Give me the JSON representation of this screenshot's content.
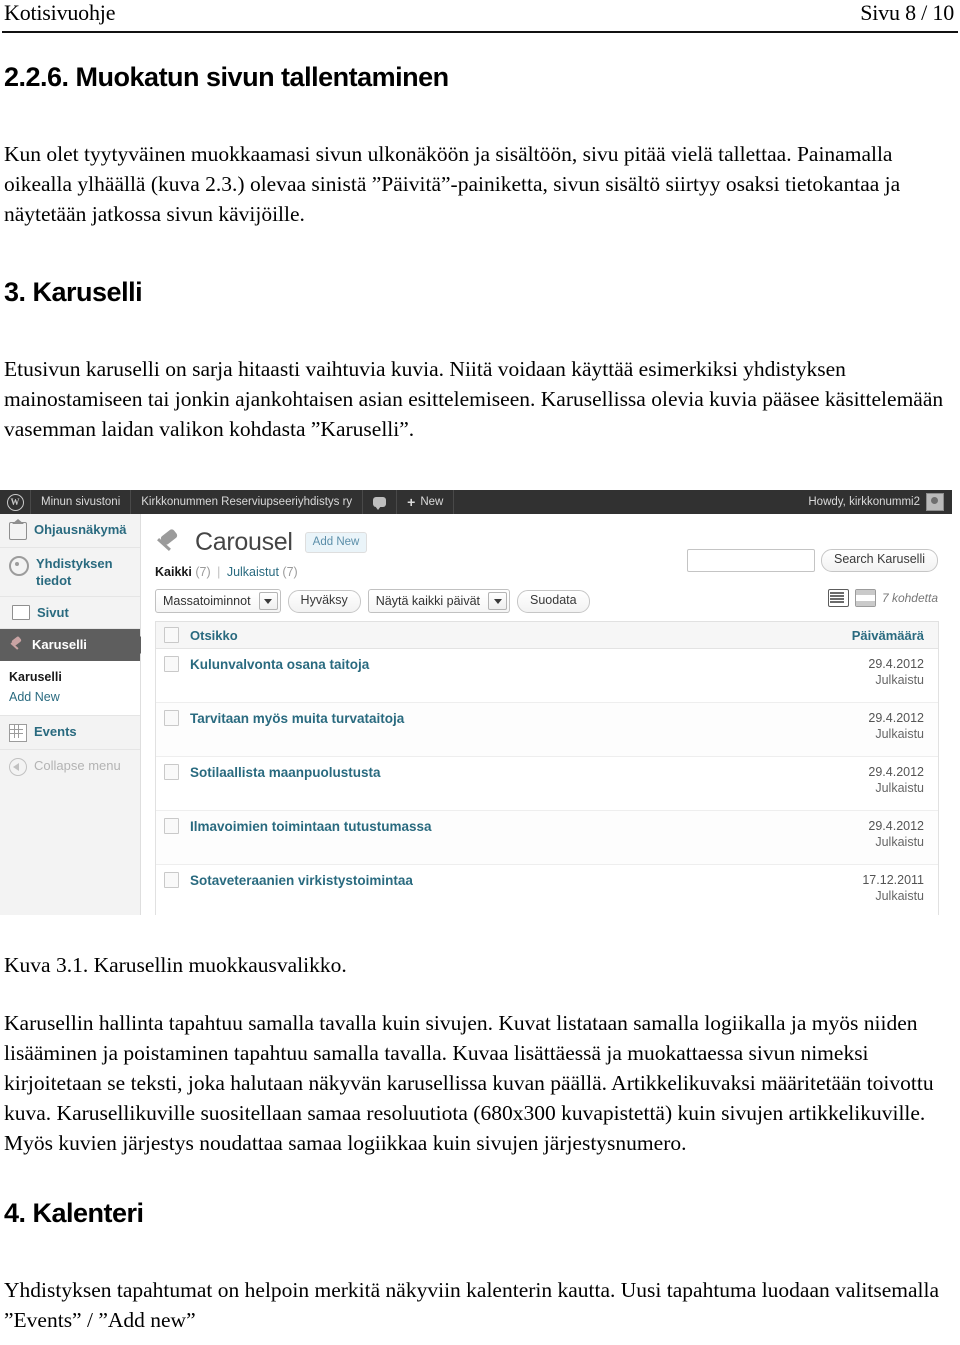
{
  "page_header": {
    "left": "Kotisivuohje",
    "right": "Sivu 8 / 10"
  },
  "sections": {
    "s226_heading": "2.2.6. Muokatun sivun tallentaminen",
    "s226_body": "Kun olet tyytyväinen muokkaamasi sivun ulkonäköön ja sisältöön, sivu pitää vielä tallettaa. Painamalla oikealla ylhäällä (kuva 2.3.) olevaa sinistä ”Päivitä”-painiketta, sivun sisältö siirtyy osaksi tietokantaa ja näytetään jatkossa sivun kävijöille.",
    "s3_heading": "3. Karuselli",
    "s3_body": "Etusivun karuselli on sarja hitaasti vaihtuvia kuvia. Niitä voidaan käyttää esimerkiksi yhdistyksen mainostamiseen tai jonkin ajankohtaisen asian esittelemiseen. Karusellissa olevia kuvia pääsee käsittelemään vasemman laidan valikon kohdasta ”Karuselli”.",
    "figure_caption": "Kuva 3.1. Karusellin muokkausvalikko.",
    "s3_after_body": "Karusellin hallinta tapahtuu samalla tavalla kuin sivujen. Kuvat listataan samalla logiikalla ja myös niiden lisääminen ja poistaminen tapahtuu samalla tavalla. Kuvaa lisättäessä ja muokattaessa sivun nimeksi kirjoitetaan se teksti, joka halutaan näkyvän karusellissa kuvan päällä. Artikkelikuvaksi määritetään toivottu kuva. Karusellikuville suositellaan samaa resoluutiota (680x300 kuvapistettä) kuin sivujen artikkelikuville. Myös kuvien järjestys noudattaa samaa logiikkaa kuin sivujen järjestysnumero.",
    "s4_heading": "4. Kalenteri",
    "s4_body": "Yhdistyksen tapahtumat on helpoin merkitä näkyviin kalenterin kautta. Uusi tapahtuma luodaan valitsemalla ”Events” / ”Add new”"
  },
  "screenshot": {
    "adminbar": {
      "logo": "wordpress-logo",
      "my_sites": "Minun sivustoni",
      "site_name": "Kirkkonummen Reserviupseeriyhdistys ry",
      "comments_icon": "comment-icon",
      "new_label": "New",
      "howdy": "Howdy, kirkkonummi2"
    },
    "sidebar": {
      "items": [
        {
          "label": "Ohjausnäkymä",
          "icon": "home-icon"
        },
        {
          "label": "Yhdistyksen tiedot",
          "icon": "gear-icon"
        },
        {
          "label": "Sivut",
          "icon": "pages-icon"
        },
        {
          "label": "Karuselli",
          "icon": "pin-icon"
        },
        {
          "label": "Events",
          "icon": "grid-icon"
        }
      ],
      "submenu": [
        {
          "label": "Karuselli",
          "active": true
        },
        {
          "label": "Add New",
          "active": false
        }
      ],
      "collapse": "Collapse menu"
    },
    "content": {
      "heading": "Carousel",
      "heading_icon": "pin-icon",
      "add_new": "Add New",
      "filters": {
        "all_label": "Kaikki",
        "all_count": "(7)",
        "separator": "|",
        "published_label": "Julkaistut",
        "published_count": "(7)"
      },
      "bulk_action": "Massatoiminnot",
      "apply_button": "Hyväksy",
      "date_filter": "Näytä kaikki päivät",
      "filter_button": "Suodata",
      "search_placeholder": "",
      "search_button": "Search Karuselli",
      "item_count": "7 kohdetta",
      "view_list_icon": "list-view-icon",
      "view_excerpt_icon": "excerpt-view-icon",
      "columns": {
        "title": "Otsikko",
        "date": "Päivämäärä"
      },
      "rows": [
        {
          "title": "Kulunvalvonta osana taitoja",
          "date": "29.4.2012",
          "status": "Julkaistu"
        },
        {
          "title": "Tarvitaan myös muita turvataitoja",
          "date": "29.4.2012",
          "status": "Julkaistu"
        },
        {
          "title": "Sotilaallista maanpuolustusta",
          "date": "29.4.2012",
          "status": "Julkaistu"
        },
        {
          "title": "Ilmavoimien toimintaan tutustumassa",
          "date": "29.4.2012",
          "status": "Julkaistu"
        },
        {
          "title": "Sotaveteraanien virkistystoimintaa",
          "date": "17.12.2011",
          "status": "Julkaistu"
        }
      ]
    }
  }
}
